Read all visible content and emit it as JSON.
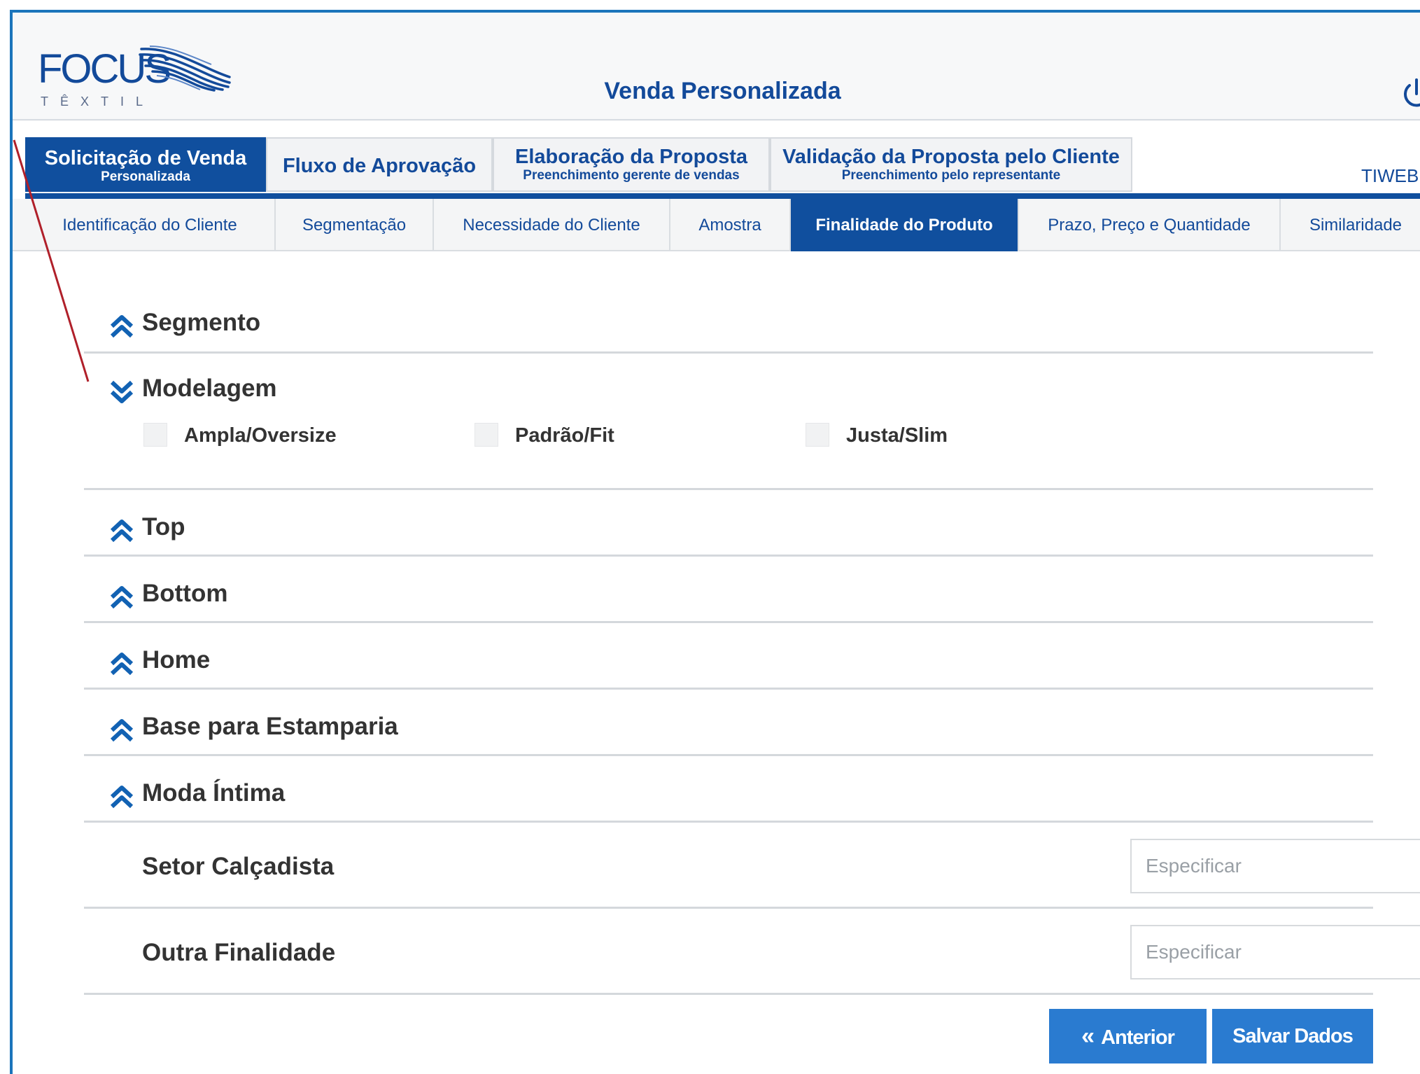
{
  "header": {
    "logo": {
      "brand": "FOCUS",
      "sub": "TÊXTIL"
    },
    "title": "Venda Personalizada",
    "user": "TIWEB"
  },
  "main_tabs": [
    {
      "label": "Solicitação de Venda",
      "sub": "Personalizada",
      "active": true
    },
    {
      "label": "Fluxo de Aprovação",
      "sub": ""
    },
    {
      "label": "Elaboração da Proposta",
      "sub": "Preenchimento gerente de vendas"
    },
    {
      "label": "Validação da Proposta pelo Cliente",
      "sub": "Preenchimento pelo representante"
    }
  ],
  "sub_tabs": [
    {
      "label": "Identificação do Cliente"
    },
    {
      "label": "Segmentação"
    },
    {
      "label": "Necessidade do Cliente"
    },
    {
      "label": "Amostra"
    },
    {
      "label": "Finalidade do Produto",
      "active": true
    },
    {
      "label": "Prazo, Preço e Quantidade"
    },
    {
      "label": "Similaridade"
    }
  ],
  "sections": {
    "segmento": {
      "title": "Segmento",
      "state": "collapsed"
    },
    "modelagem": {
      "title": "Modelagem",
      "state": "expanded",
      "options": [
        {
          "label": "Ampla/Oversize",
          "checked": false
        },
        {
          "label": "Padrão/Fit",
          "checked": false
        },
        {
          "label": "Justa/Slim",
          "checked": false
        }
      ]
    },
    "top": {
      "title": "Top",
      "state": "collapsed"
    },
    "bottom": {
      "title": "Bottom",
      "state": "collapsed"
    },
    "home": {
      "title": "Home",
      "state": "collapsed"
    },
    "base": {
      "title": "Base para Estamparia",
      "state": "collapsed"
    },
    "moda": {
      "title": "Moda Íntima",
      "state": "collapsed"
    }
  },
  "fields": {
    "setor": {
      "label": "Setor Calçadista",
      "placeholder": "Especificar",
      "value": ""
    },
    "outra": {
      "label": "Outra Finalidade",
      "placeholder": "Especificar",
      "value": ""
    }
  },
  "buttons": {
    "prev": {
      "label": "Anterior"
    },
    "save": {
      "label": "Salvar Dados"
    }
  },
  "colors": {
    "primary": "#104f9e",
    "title": "#134a9a",
    "button": "#2a7bd0",
    "annotation": "#b0202a"
  },
  "icons": {
    "collapsed": "chevron-double-up-icon",
    "expanded": "chevron-double-down-icon",
    "power": "power-icon"
  }
}
